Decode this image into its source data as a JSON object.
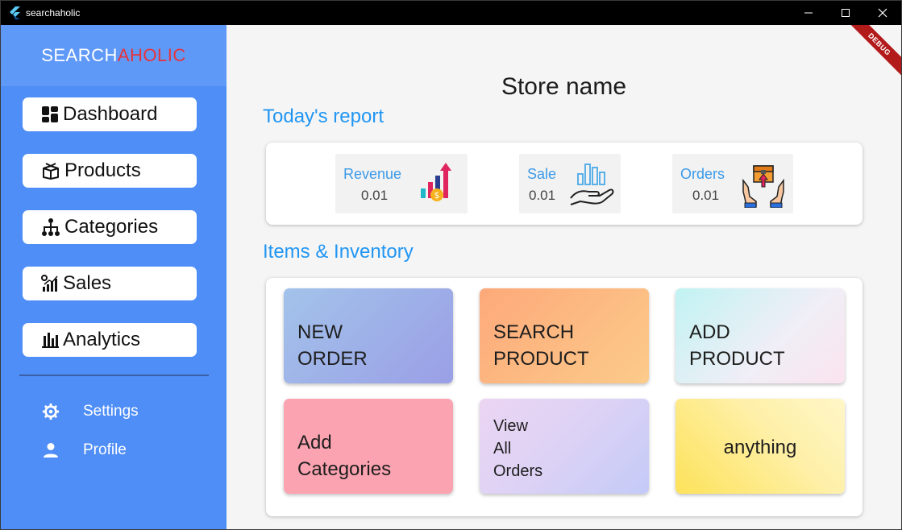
{
  "window": {
    "title": "searchaholic"
  },
  "brand": {
    "part1": "SEARCH",
    "part2": "AHOLIC"
  },
  "nav": {
    "items": [
      {
        "label": "Dashboard",
        "icon": "dashboard-icon"
      },
      {
        "label": "Products",
        "icon": "box-icon"
      },
      {
        "label": "Categories",
        "icon": "hierarchy-icon"
      },
      {
        "label": "Sales",
        "icon": "sales-chart-icon"
      },
      {
        "label": "Analytics",
        "icon": "bar-chart-icon"
      }
    ],
    "links": [
      {
        "label": "Settings",
        "icon": "gear-icon"
      },
      {
        "label": "Profile",
        "icon": "person-icon"
      }
    ]
  },
  "debug_banner": "DEBUG",
  "main": {
    "store_name": "Store name",
    "report_title": "Today's report",
    "stats": [
      {
        "label": "Revenue",
        "value": "0.01",
        "icon": "revenue-growth-icon"
      },
      {
        "label": "Sale",
        "value": "0.01",
        "icon": "hand-chart-icon"
      },
      {
        "label": "Orders",
        "value": "0.01",
        "icon": "package-hands-icon"
      }
    ],
    "inventory_title": "Items & Inventory",
    "tiles": [
      {
        "line1": "NEW",
        "line2": "ORDER"
      },
      {
        "line1": "SEARCH",
        "line2": "PRODUCT"
      },
      {
        "line1": "ADD",
        "line2": "PRODUCT"
      },
      {
        "line1": "Add",
        "line2": "Categories"
      },
      {
        "line1": "View",
        "line2": "All",
        "line3": "Orders"
      },
      {
        "line1": "anything"
      }
    ]
  },
  "colors": {
    "sidebar": "#4f8ef7",
    "accent": "#2196f3",
    "brand_red": "#e5343d"
  }
}
